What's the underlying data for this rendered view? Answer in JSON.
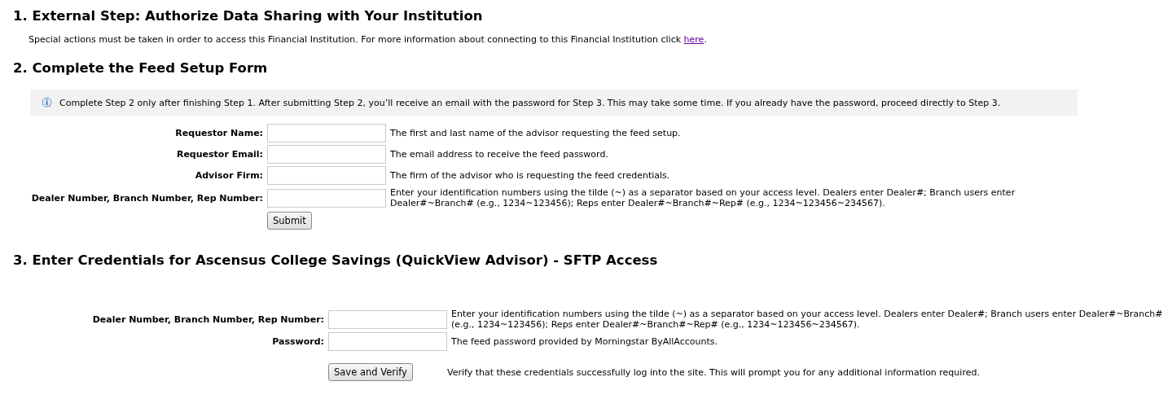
{
  "steps": [
    {
      "kind": "external",
      "title": "1. External Step: Authorize Data Sharing with Your Institution",
      "text": "Special actions must be taken in order to access this Financial Institution. For more information about connecting to this Financial Institution click ",
      "link": "here",
      "after": "."
    },
    {
      "kind": "form",
      "title": "2. Complete the Feed Setup Form",
      "notice": "Complete Step 2 only after finishing Step 1. After submitting Step 2, you’ll receive an email with the password for Step 3. This may take some time. If you already have the password, proceed directly to Step 3.",
      "fields": [
        {
          "label": "Requestor Name:",
          "help": "The first and last name of the advisor requesting the feed setup."
        },
        {
          "label": "Requestor Email:",
          "help": "The email address to receive the feed password."
        },
        {
          "label": "Advisor Firm:",
          "help": "The firm of the advisor who is requesting the feed credentials."
        },
        {
          "label": "Dealer Number, Branch Number, Rep Number:",
          "help": "Enter your identification numbers using the tilde (~) as a separator based on your access level. Dealers enter Dealer#; Branch users enter Dealer#~Branch# (e.g., 1234~123456); Reps enter Dealer#~Branch#~Rep# (e.g., 1234~123456~234567)."
        }
      ],
      "button": "Submit"
    },
    {
      "kind": "credentials",
      "title": "3. Enter Credentials for Ascensus College Savings (QuickView Advisor) - SFTP Access",
      "fields": [
        {
          "label": "Dealer Number, Branch Number, Rep Number:",
          "help": "Enter your identification numbers using the tilde (~) as a separator based on your access level. Dealers enter Dealer#; Branch users enter Dealer#~Branch# (e.g., 1234~123456); Reps enter Dealer#~Branch#~Rep# (e.g., 1234~123456~234567)."
        },
        {
          "label": "Password:",
          "help": "The feed password provided by Morningstar ByAllAccounts."
        }
      ],
      "button": "Save and Verify",
      "button_help": "Verify that these credentials successfully log into the site. This will prompt you for any additional information required."
    }
  ]
}
